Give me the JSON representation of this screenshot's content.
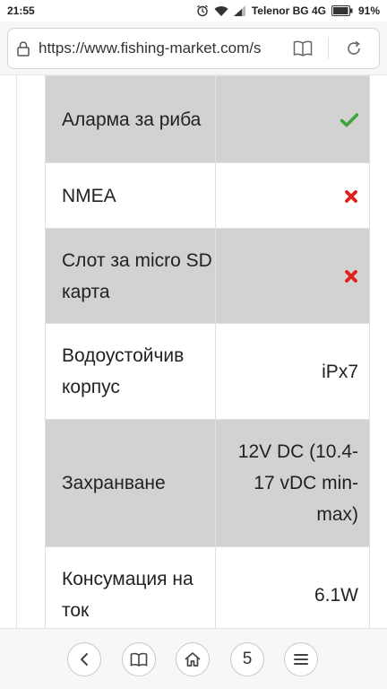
{
  "status_bar": {
    "time": "21:55",
    "carrier": "Telenor BG 4G",
    "battery": "91%"
  },
  "browser": {
    "url": "https://www.fishing-market.com/s",
    "tabs_count": "5"
  },
  "specs": [
    {
      "label": "Аларма за риба",
      "value": "",
      "value_icon": "check-icon",
      "shaded": true
    },
    {
      "label": "NMEA",
      "value": "",
      "value_icon": "cross-icon",
      "shaded": false
    },
    {
      "label": "Слот за micro SD карта",
      "value": "",
      "value_icon": "cross-icon",
      "shaded": true
    },
    {
      "label": "Водоустойчив корпус",
      "value": "iPx7",
      "value_icon": "",
      "shaded": false
    },
    {
      "label": "Захранване",
      "value": "12V DC (10.4-17 vDC min-max)",
      "value_icon": "",
      "shaded": true
    },
    {
      "label": "Консумация на ток",
      "value": "6.1W",
      "value_icon": "",
      "shaded": false
    }
  ],
  "colors": {
    "check": "#3ea33a",
    "cross": "#e0201b",
    "shaded_row": "#d2d2d2"
  }
}
